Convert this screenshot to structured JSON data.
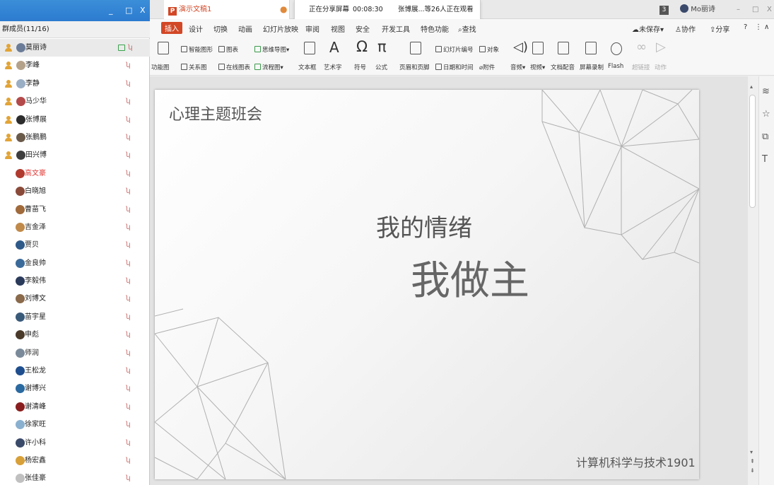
{
  "window": {
    "doc_tab": "演示文稿1",
    "share_status": "正在分享屏幕",
    "share_timer": "00:08:30",
    "share_viewers": "张博展...等26人正在观看",
    "badge": "3",
    "account": "Mo丽诗",
    "minimize_glyph": "–",
    "restore_glyph": "□",
    "close_glyph": "X"
  },
  "menu": {
    "items": [
      "插入",
      "设计",
      "切换",
      "动画",
      "幻灯片放映",
      "审阅",
      "视图",
      "安全",
      "开发工具",
      "特色功能",
      "查找"
    ],
    "right": [
      "未保存",
      "协作",
      "分享"
    ]
  },
  "ribbon": {
    "items": [
      "功能图",
      "智能图形",
      "图表",
      "关系图",
      "在线图表",
      "思维导图",
      "流程图",
      "文本框",
      "艺术字",
      "符号",
      "公式",
      "页眉和页脚",
      "幻灯片编号",
      "对象",
      "日期和时间",
      "附件",
      "音频",
      "视频",
      "文档配音",
      "屏幕录制",
      "Flash",
      "超链接",
      "动作"
    ]
  },
  "panel": {
    "title_min": "_",
    "title_max": "□",
    "title_close": "X",
    "members_label": "群成员(11/16)",
    "members": [
      {
        "name": "莫丽诗",
        "host": true,
        "selected": true,
        "camera": true,
        "avatar": "#6b7c98"
      },
      {
        "name": "李峰",
        "host": true,
        "avatar": "#b5a28a"
      },
      {
        "name": "李静",
        "host": true,
        "avatar": "#9aaec4"
      },
      {
        "name": "马少华",
        "host": true,
        "avatar": "#b44a4a"
      },
      {
        "name": "张博展",
        "host": true,
        "avatar": "#2c2c2c"
      },
      {
        "name": "张鹏鹏",
        "host": true,
        "avatar": "#6a5a4a"
      },
      {
        "name": "田兴博",
        "host": true,
        "avatar": "#3e3e3e"
      },
      {
        "name": "高文豪",
        "red": true,
        "avatar": "#b03a2e"
      },
      {
        "name": "白晓旭",
        "avatar": "#8a4a3a"
      },
      {
        "name": "曹苗飞",
        "avatar": "#a06a3a"
      },
      {
        "name": "吉金泽",
        "avatar": "#c08a4a"
      },
      {
        "name": "贾贝",
        "avatar": "#2e5a8a"
      },
      {
        "name": "金良帅",
        "avatar": "#3a6a9a"
      },
      {
        "name": "李毅伟",
        "avatar": "#2a3a5a"
      },
      {
        "name": "刘博文",
        "avatar": "#8a6a4a"
      },
      {
        "name": "苗宇星",
        "avatar": "#3a5a7a"
      },
      {
        "name": "申彪",
        "avatar": "#4a3a2a"
      },
      {
        "name": "师润",
        "avatar": "#7a8a9a"
      },
      {
        "name": "王松龙",
        "avatar": "#1e4e8e"
      },
      {
        "name": "谢博兴",
        "avatar": "#2a6aa0"
      },
      {
        "name": "谢清峰",
        "avatar": "#8a1e1e"
      },
      {
        "name": "徐家旺",
        "avatar": "#8ab0d0"
      },
      {
        "name": "许小科",
        "avatar": "#3a4a6a"
      },
      {
        "name": "杨宏鑫",
        "avatar": "#d8a038"
      },
      {
        "name": "张佳豪",
        "avatar": "#c0c0c0"
      }
    ]
  },
  "slide": {
    "title": "心理主题班会",
    "line1": "我的情绪",
    "line2": "我做主",
    "footer": "计算机科学与技术1901"
  },
  "icons": {
    "mute": "microphone-off-icon",
    "camera": "camera-icon",
    "search": "search-icon"
  }
}
